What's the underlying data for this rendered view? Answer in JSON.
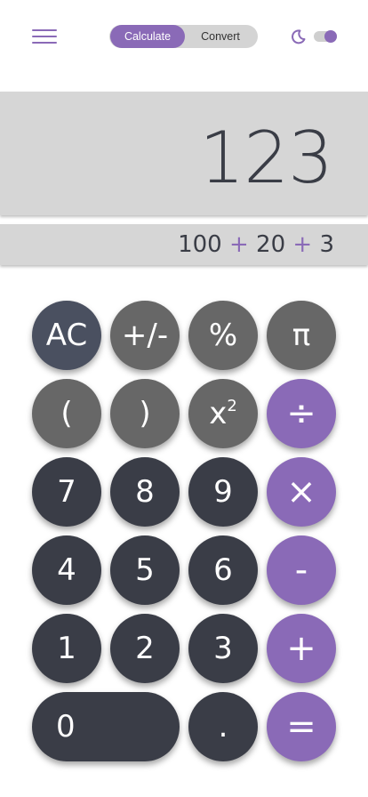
{
  "header": {
    "mode_tabs": [
      {
        "label": "Calculate",
        "active": true
      },
      {
        "label": "Convert",
        "active": false
      }
    ],
    "menu_icon": "hamburger-menu-icon",
    "theme_icon": "moon-icon",
    "theme_toggle_on": true
  },
  "display": {
    "value": "123",
    "expression": {
      "parts": [
        "100",
        "+",
        "20",
        "+",
        "3"
      ]
    }
  },
  "keypad": {
    "rows": [
      [
        "AC",
        "+/-",
        "%",
        "π"
      ],
      [
        "(",
        ")",
        "x",
        "÷"
      ],
      [
        "7",
        "8",
        "9",
        "×"
      ],
      [
        "4",
        "5",
        "6",
        "-"
      ],
      [
        "1",
        "2",
        "3",
        "+"
      ],
      [
        "0",
        ".",
        "="
      ]
    ],
    "square_superscript": "2"
  },
  "colors": {
    "accent": "#8a6ab7",
    "function_key": "#676767",
    "number_key": "#3a3d47",
    "clear_key": "#4a5060",
    "display_bg": "#d6d6d6",
    "text_dark": "#3a3d46"
  }
}
